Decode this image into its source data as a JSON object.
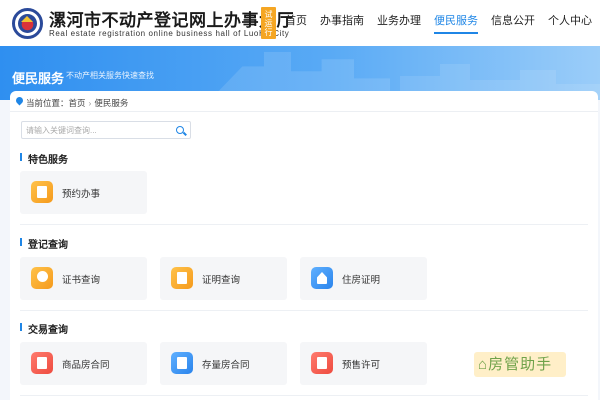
{
  "header": {
    "title": "漯河市不动产登记网上办事大厅",
    "subtitle": "Real estate registration online business hall of LuoHe City",
    "trial_badge": "试运行",
    "nav": [
      {
        "label": "首页",
        "active": false
      },
      {
        "label": "办事指南",
        "active": false
      },
      {
        "label": "业务办理",
        "active": false
      },
      {
        "label": "便民服务",
        "active": true
      },
      {
        "label": "信息公开",
        "active": false
      },
      {
        "label": "个人中心",
        "active": false
      }
    ]
  },
  "banner": {
    "title": "便民服务",
    "desc": "不动产相关服务快速查找"
  },
  "breadcrumb": {
    "prefix": "当前位置：",
    "home": "首页",
    "current": "便民服务"
  },
  "search": {
    "placeholder": "请输入关键词查询..."
  },
  "sections": [
    {
      "title": "特色服务",
      "items": [
        {
          "label": "预约办事",
          "icon": "calendar-icon",
          "color": "#f5a623"
        }
      ]
    },
    {
      "title": "登记查询",
      "items": [
        {
          "label": "证书查询",
          "icon": "certificate-icon",
          "color": "#f5a623"
        },
        {
          "label": "证明查询",
          "icon": "document-icon",
          "color": "#f5a623"
        },
        {
          "label": "住房证明",
          "icon": "house-icon",
          "color": "#2a84ec"
        }
      ]
    },
    {
      "title": "交易查询",
      "items": [
        {
          "label": "商品房合同",
          "icon": "contract-icon",
          "color": "#ee4b3f"
        },
        {
          "label": "存量房合同",
          "icon": "search-document-icon",
          "color": "#2a84ec"
        },
        {
          "label": "预售许可",
          "icon": "permit-icon",
          "color": "#ee4b3f"
        }
      ]
    }
  ],
  "watermark": "房管助手",
  "colors": {
    "accent": "#1f86e6",
    "banner": "#2f8ff0"
  }
}
